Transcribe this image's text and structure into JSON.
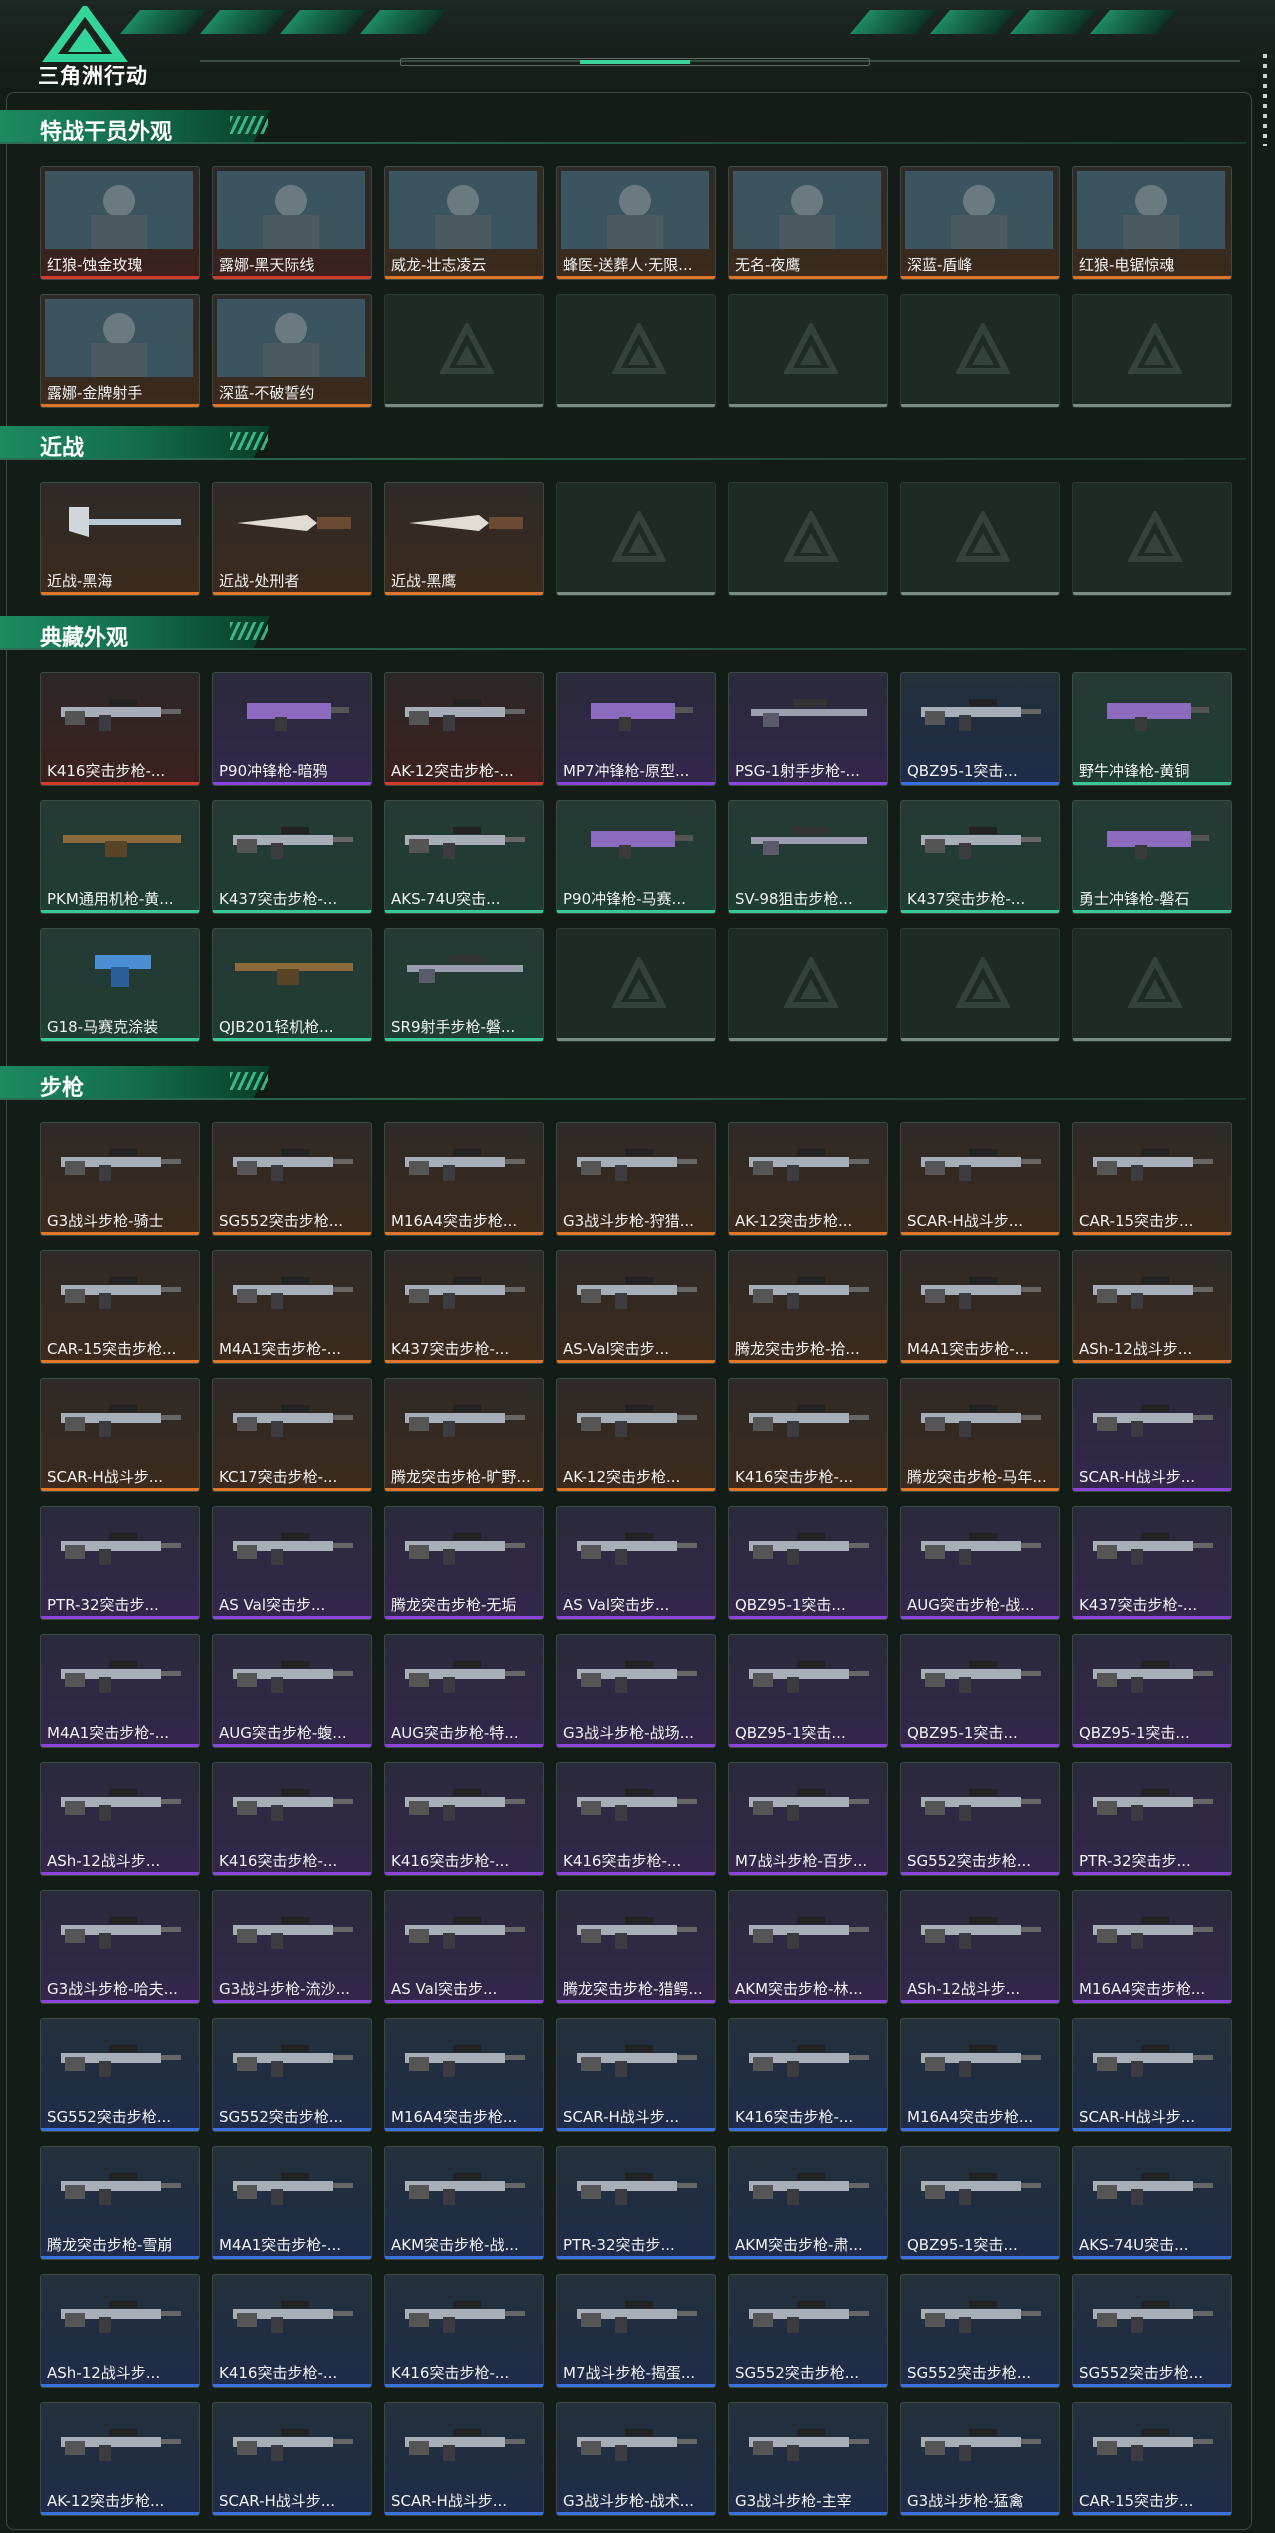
{
  "app": {
    "title": "三角洲行动"
  },
  "colors": {
    "accent": "#3ad39a",
    "red": "#d33a2c",
    "orange": "#e07426",
    "purple": "#8a46dc",
    "teal": "#3ac79a",
    "blue": "#3a70e0"
  },
  "sections": [
    {
      "title": "特战干员外观",
      "items": [
        {
          "label": "红狼-蚀金玫瑰",
          "rarity": "red",
          "icon": "operator-portrait"
        },
        {
          "label": "露娜-黑天际线",
          "rarity": "red",
          "icon": "operator-portrait"
        },
        {
          "label": "威龙-壮志凌云",
          "rarity": "orange",
          "icon": "operator-portrait"
        },
        {
          "label": "蜂医-送葬人·无限...",
          "rarity": "orange",
          "icon": "operator-portrait"
        },
        {
          "label": "无名-夜鹰",
          "rarity": "orange",
          "icon": "operator-portrait"
        },
        {
          "label": "深蓝-盾峰",
          "rarity": "orange",
          "icon": "operator-portrait"
        },
        {
          "label": "红狼-电锯惊魂",
          "rarity": "orange",
          "icon": "operator-portrait"
        },
        {
          "label": "露娜-金牌射手",
          "rarity": "orange",
          "icon": "operator-portrait"
        },
        {
          "label": "深蓝-不破誓约",
          "rarity": "orange",
          "icon": "operator-portrait"
        },
        {
          "label": "",
          "rarity": "empty"
        },
        {
          "label": "",
          "rarity": "empty"
        },
        {
          "label": "",
          "rarity": "empty"
        },
        {
          "label": "",
          "rarity": "empty"
        },
        {
          "label": "",
          "rarity": "empty"
        }
      ]
    },
    {
      "title": "近战",
      "items": [
        {
          "label": "近战-黑海",
          "rarity": "orange",
          "icon": "melee-axe-icon"
        },
        {
          "label": "近战-处刑者",
          "rarity": "orange",
          "icon": "melee-knife-icon"
        },
        {
          "label": "近战-黑鹰",
          "rarity": "orange",
          "icon": "melee-knife-icon"
        },
        {
          "label": "",
          "rarity": "empty"
        },
        {
          "label": "",
          "rarity": "empty"
        },
        {
          "label": "",
          "rarity": "empty"
        },
        {
          "label": "",
          "rarity": "empty"
        }
      ]
    },
    {
      "title": "典藏外观",
      "items": [
        {
          "label": "K416突击步枪-...",
          "rarity": "red",
          "icon": "rifle-icon"
        },
        {
          "label": "P90冲锋枪-暗鸦",
          "rarity": "purple",
          "icon": "smg-icon"
        },
        {
          "label": "AK-12突击步枪-...",
          "rarity": "red",
          "icon": "rifle-icon"
        },
        {
          "label": "MP7冲锋枪-原型...",
          "rarity": "purple",
          "icon": "smg-icon"
        },
        {
          "label": "PSG-1射手步枪-...",
          "rarity": "purple",
          "icon": "sniper-icon"
        },
        {
          "label": "QBZ95-1突击...",
          "rarity": "blue",
          "icon": "rifle-icon"
        },
        {
          "label": "野牛冲锋枪-黄铜",
          "rarity": "teal",
          "icon": "smg-icon"
        },
        {
          "label": "PKM通用机枪-黄...",
          "rarity": "teal",
          "icon": "lmg-icon"
        },
        {
          "label": "K437突击步枪-...",
          "rarity": "teal",
          "icon": "rifle-icon"
        },
        {
          "label": "AKS-74U突击...",
          "rarity": "teal",
          "icon": "rifle-icon"
        },
        {
          "label": "P90冲锋枪-马赛...",
          "rarity": "teal",
          "icon": "smg-icon"
        },
        {
          "label": "SV-98狙击步枪...",
          "rarity": "teal",
          "icon": "sniper-icon"
        },
        {
          "label": "K437突击步枪-...",
          "rarity": "teal",
          "icon": "rifle-icon"
        },
        {
          "label": "勇士冲锋枪-磐石",
          "rarity": "teal",
          "icon": "smg-icon"
        },
        {
          "label": "G18-马赛克涂装",
          "rarity": "teal",
          "icon": "pistol-icon"
        },
        {
          "label": "QJB201轻机枪...",
          "rarity": "teal",
          "icon": "lmg-icon"
        },
        {
          "label": "SR9射手步枪-磐...",
          "rarity": "teal",
          "icon": "sniper-icon"
        },
        {
          "label": "",
          "rarity": "empty"
        },
        {
          "label": "",
          "rarity": "empty"
        },
        {
          "label": "",
          "rarity": "empty"
        },
        {
          "label": "",
          "rarity": "empty"
        }
      ]
    },
    {
      "title": "步枪",
      "items": [
        {
          "label": "G3战斗步枪-骑士",
          "rarity": "orange",
          "icon": "rifle-icon"
        },
        {
          "label": "SG552突击步枪...",
          "rarity": "orange",
          "icon": "rifle-icon"
        },
        {
          "label": "M16A4突击步枪...",
          "rarity": "orange",
          "icon": "rifle-icon"
        },
        {
          "label": "G3战斗步枪-狩猎...",
          "rarity": "orange",
          "icon": "rifle-icon"
        },
        {
          "label": "AK-12突击步枪...",
          "rarity": "orange",
          "icon": "rifle-icon"
        },
        {
          "label": "SCAR-H战斗步...",
          "rarity": "orange",
          "icon": "rifle-icon"
        },
        {
          "label": "CAR-15突击步...",
          "rarity": "orange",
          "icon": "rifle-icon"
        },
        {
          "label": "CAR-15突击步枪...",
          "rarity": "orange",
          "icon": "rifle-icon"
        },
        {
          "label": "M4A1突击步枪-...",
          "rarity": "orange",
          "icon": "rifle-icon"
        },
        {
          "label": "K437突击步枪-...",
          "rarity": "orange",
          "icon": "rifle-icon"
        },
        {
          "label": "AS-Val突击步...",
          "rarity": "orange",
          "icon": "rifle-icon"
        },
        {
          "label": "腾龙突击步枪-拾...",
          "rarity": "orange",
          "icon": "rifle-icon"
        },
        {
          "label": "M4A1突击步枪-...",
          "rarity": "orange",
          "icon": "rifle-icon"
        },
        {
          "label": "ASh-12战斗步...",
          "rarity": "orange",
          "icon": "rifle-icon"
        },
        {
          "label": "SCAR-H战斗步...",
          "rarity": "orange",
          "icon": "rifle-icon"
        },
        {
          "label": "KC17突击步枪-...",
          "rarity": "orange",
          "icon": "rifle-icon"
        },
        {
          "label": "腾龙突击步枪-旷野...",
          "rarity": "orange",
          "icon": "rifle-icon"
        },
        {
          "label": "AK-12突击步枪...",
          "rarity": "orange",
          "icon": "rifle-icon"
        },
        {
          "label": "K416突击步枪-...",
          "rarity": "orange",
          "icon": "rifle-icon"
        },
        {
          "label": "腾龙突击步枪-马年...",
          "rarity": "orange",
          "icon": "rifle-icon"
        },
        {
          "label": "SCAR-H战斗步...",
          "rarity": "purple",
          "icon": "rifle-icon"
        },
        {
          "label": "PTR-32突击步...",
          "rarity": "purple",
          "icon": "rifle-icon"
        },
        {
          "label": "AS Val突击步...",
          "rarity": "purple",
          "icon": "rifle-icon"
        },
        {
          "label": "腾龙突击步枪-无垢",
          "rarity": "purple",
          "icon": "rifle-icon"
        },
        {
          "label": "AS Val突击步...",
          "rarity": "purple",
          "icon": "rifle-icon"
        },
        {
          "label": "QBZ95-1突击...",
          "rarity": "purple",
          "icon": "rifle-icon"
        },
        {
          "label": "AUG突击步枪-战...",
          "rarity": "purple",
          "icon": "rifle-icon"
        },
        {
          "label": "K437突击步枪-...",
          "rarity": "purple",
          "icon": "rifle-icon"
        },
        {
          "label": "M4A1突击步枪-...",
          "rarity": "purple",
          "icon": "rifle-icon"
        },
        {
          "label": "AUG突击步枪-蝮...",
          "rarity": "purple",
          "icon": "rifle-icon"
        },
        {
          "label": "AUG突击步枪-特...",
          "rarity": "purple",
          "icon": "rifle-icon"
        },
        {
          "label": "G3战斗步枪-战场...",
          "rarity": "purple",
          "icon": "rifle-icon"
        },
        {
          "label": "QBZ95-1突击...",
          "rarity": "purple",
          "icon": "rifle-icon"
        },
        {
          "label": "QBZ95-1突击...",
          "rarity": "purple",
          "icon": "rifle-icon"
        },
        {
          "label": "QBZ95-1突击...",
          "rarity": "purple",
          "icon": "rifle-icon"
        },
        {
          "label": "ASh-12战斗步...",
          "rarity": "purple",
          "icon": "rifle-icon"
        },
        {
          "label": "K416突击步枪-...",
          "rarity": "purple",
          "icon": "rifle-icon"
        },
        {
          "label": "K416突击步枪-...",
          "rarity": "purple",
          "icon": "rifle-icon"
        },
        {
          "label": "K416突击步枪-...",
          "rarity": "purple",
          "icon": "rifle-icon"
        },
        {
          "label": "M7战斗步枪-百步...",
          "rarity": "purple",
          "icon": "rifle-icon"
        },
        {
          "label": "SG552突击步枪...",
          "rarity": "purple",
          "icon": "rifle-icon"
        },
        {
          "label": "PTR-32突击步...",
          "rarity": "purple",
          "icon": "rifle-icon"
        },
        {
          "label": "G3战斗步枪-哈夫...",
          "rarity": "purple",
          "icon": "rifle-icon"
        },
        {
          "label": "G3战斗步枪-流沙...",
          "rarity": "purple",
          "icon": "rifle-icon"
        },
        {
          "label": "AS Val突击步...",
          "rarity": "purple",
          "icon": "rifle-icon"
        },
        {
          "label": "腾龙突击步枪-猎鳄...",
          "rarity": "purple",
          "icon": "rifle-icon"
        },
        {
          "label": "AKM突击步枪-林...",
          "rarity": "purple",
          "icon": "rifle-icon"
        },
        {
          "label": "ASh-12战斗步...",
          "rarity": "purple",
          "icon": "rifle-icon"
        },
        {
          "label": "M16A4突击步枪...",
          "rarity": "purple",
          "icon": "rifle-icon"
        },
        {
          "label": "SG552突击步枪...",
          "rarity": "blue",
          "icon": "rifle-icon"
        },
        {
          "label": "SG552突击步枪...",
          "rarity": "blue",
          "icon": "rifle-icon"
        },
        {
          "label": "M16A4突击步枪...",
          "rarity": "blue",
          "icon": "rifle-icon"
        },
        {
          "label": "SCAR-H战斗步...",
          "rarity": "blue",
          "icon": "rifle-icon"
        },
        {
          "label": "K416突击步枪-...",
          "rarity": "blue",
          "icon": "rifle-icon"
        },
        {
          "label": "M16A4突击步枪...",
          "rarity": "blue",
          "icon": "rifle-icon"
        },
        {
          "label": "SCAR-H战斗步...",
          "rarity": "blue",
          "icon": "rifle-icon"
        },
        {
          "label": "腾龙突击步枪-雪崩",
          "rarity": "blue",
          "icon": "rifle-icon"
        },
        {
          "label": "M4A1突击步枪-...",
          "rarity": "blue",
          "icon": "rifle-icon"
        },
        {
          "label": "AKM突击步枪-战...",
          "rarity": "blue",
          "icon": "rifle-icon"
        },
        {
          "label": "PTR-32突击步...",
          "rarity": "blue",
          "icon": "rifle-icon"
        },
        {
          "label": "AKM突击步枪-肃...",
          "rarity": "blue",
          "icon": "rifle-icon"
        },
        {
          "label": "QBZ95-1突击...",
          "rarity": "blue",
          "icon": "rifle-icon"
        },
        {
          "label": "AKS-74U突击...",
          "rarity": "blue",
          "icon": "rifle-icon"
        },
        {
          "label": "ASh-12战斗步...",
          "rarity": "blue",
          "icon": "rifle-icon"
        },
        {
          "label": "K416突击步枪-...",
          "rarity": "blue",
          "icon": "rifle-icon"
        },
        {
          "label": "K416突击步枪-...",
          "rarity": "blue",
          "icon": "rifle-icon"
        },
        {
          "label": "M7战斗步枪-揭蛋...",
          "rarity": "blue",
          "icon": "rifle-icon"
        },
        {
          "label": "SG552突击步枪...",
          "rarity": "blue",
          "icon": "rifle-icon"
        },
        {
          "label": "SG552突击步枪...",
          "rarity": "blue",
          "icon": "rifle-icon"
        },
        {
          "label": "SG552突击步枪...",
          "rarity": "blue",
          "icon": "rifle-icon"
        },
        {
          "label": "AK-12突击步枪...",
          "rarity": "blue",
          "icon": "rifle-icon"
        },
        {
          "label": "SCAR-H战斗步...",
          "rarity": "blue",
          "icon": "rifle-icon"
        },
        {
          "label": "SCAR-H战斗步...",
          "rarity": "blue",
          "icon": "rifle-icon"
        },
        {
          "label": "G3战斗步枪-战术...",
          "rarity": "blue",
          "icon": "rifle-icon"
        },
        {
          "label": "G3战斗步枪-主宰",
          "rarity": "blue",
          "icon": "rifle-icon"
        },
        {
          "label": "G3战斗步枪-猛禽",
          "rarity": "blue",
          "icon": "rifle-icon"
        },
        {
          "label": "CAR-15突击步...",
          "rarity": "blue",
          "icon": "rifle-icon"
        }
      ]
    }
  ]
}
